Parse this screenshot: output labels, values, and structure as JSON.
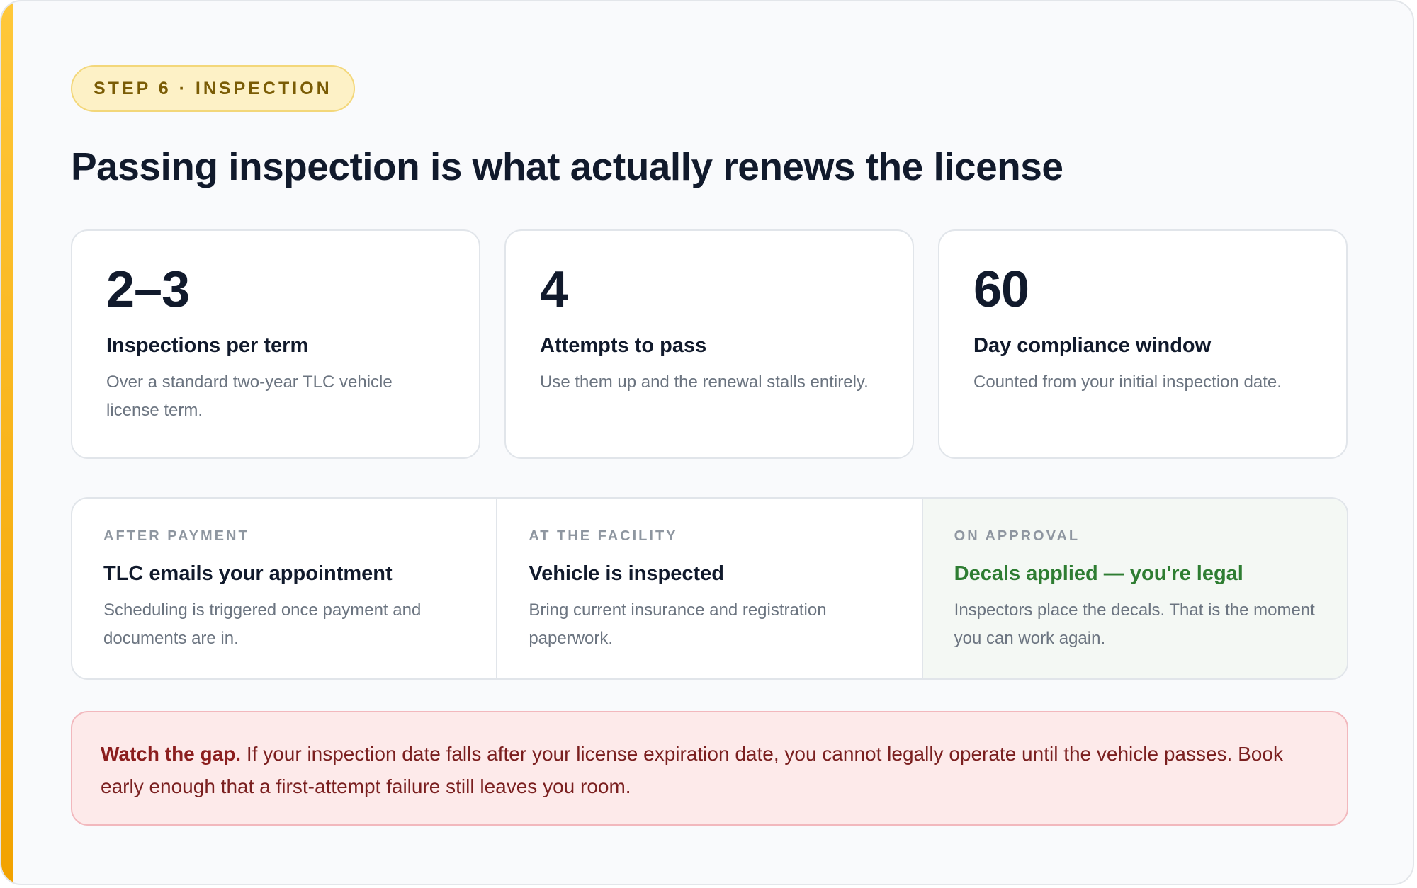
{
  "header": {
    "step_pill": "STEP 6 · INSPECTION",
    "title": "Passing inspection is what actually renews the license"
  },
  "stats": [
    {
      "value": "2–3",
      "label": "Inspections per term",
      "description": "Over a standard two-year TLC vehicle license term."
    },
    {
      "value": "4",
      "label": "Attempts to pass",
      "description": "Use them up and the renewal stalls entirely."
    },
    {
      "value": "60",
      "label": "Day compliance window",
      "description": "Counted from your initial inspection date."
    }
  ],
  "steps": [
    {
      "kicker": "AFTER PAYMENT",
      "title": "TLC emails your appointment",
      "description": "Scheduling is triggered once payment and documents are in."
    },
    {
      "kicker": "AT THE FACILITY",
      "title": "Vehicle is inspected",
      "description": "Bring current insurance and registration paperwork."
    },
    {
      "kicker": "ON APPROVAL",
      "title": "Decals applied — you're legal",
      "description": "Inspectors place the decals. That is the moment you can work again."
    }
  ],
  "warning": {
    "lead": "Watch the gap.",
    "body": " If your inspection date falls after your license expiration date, you cannot legally operate until the vehicle passes. Book early enough that a first-attempt failure still leaves you room."
  },
  "colors": {
    "accent": "#f2a200",
    "approved": "#2e7d32",
    "warning_text": "#8b1e1e",
    "warning_bg": "#fdeaea"
  }
}
